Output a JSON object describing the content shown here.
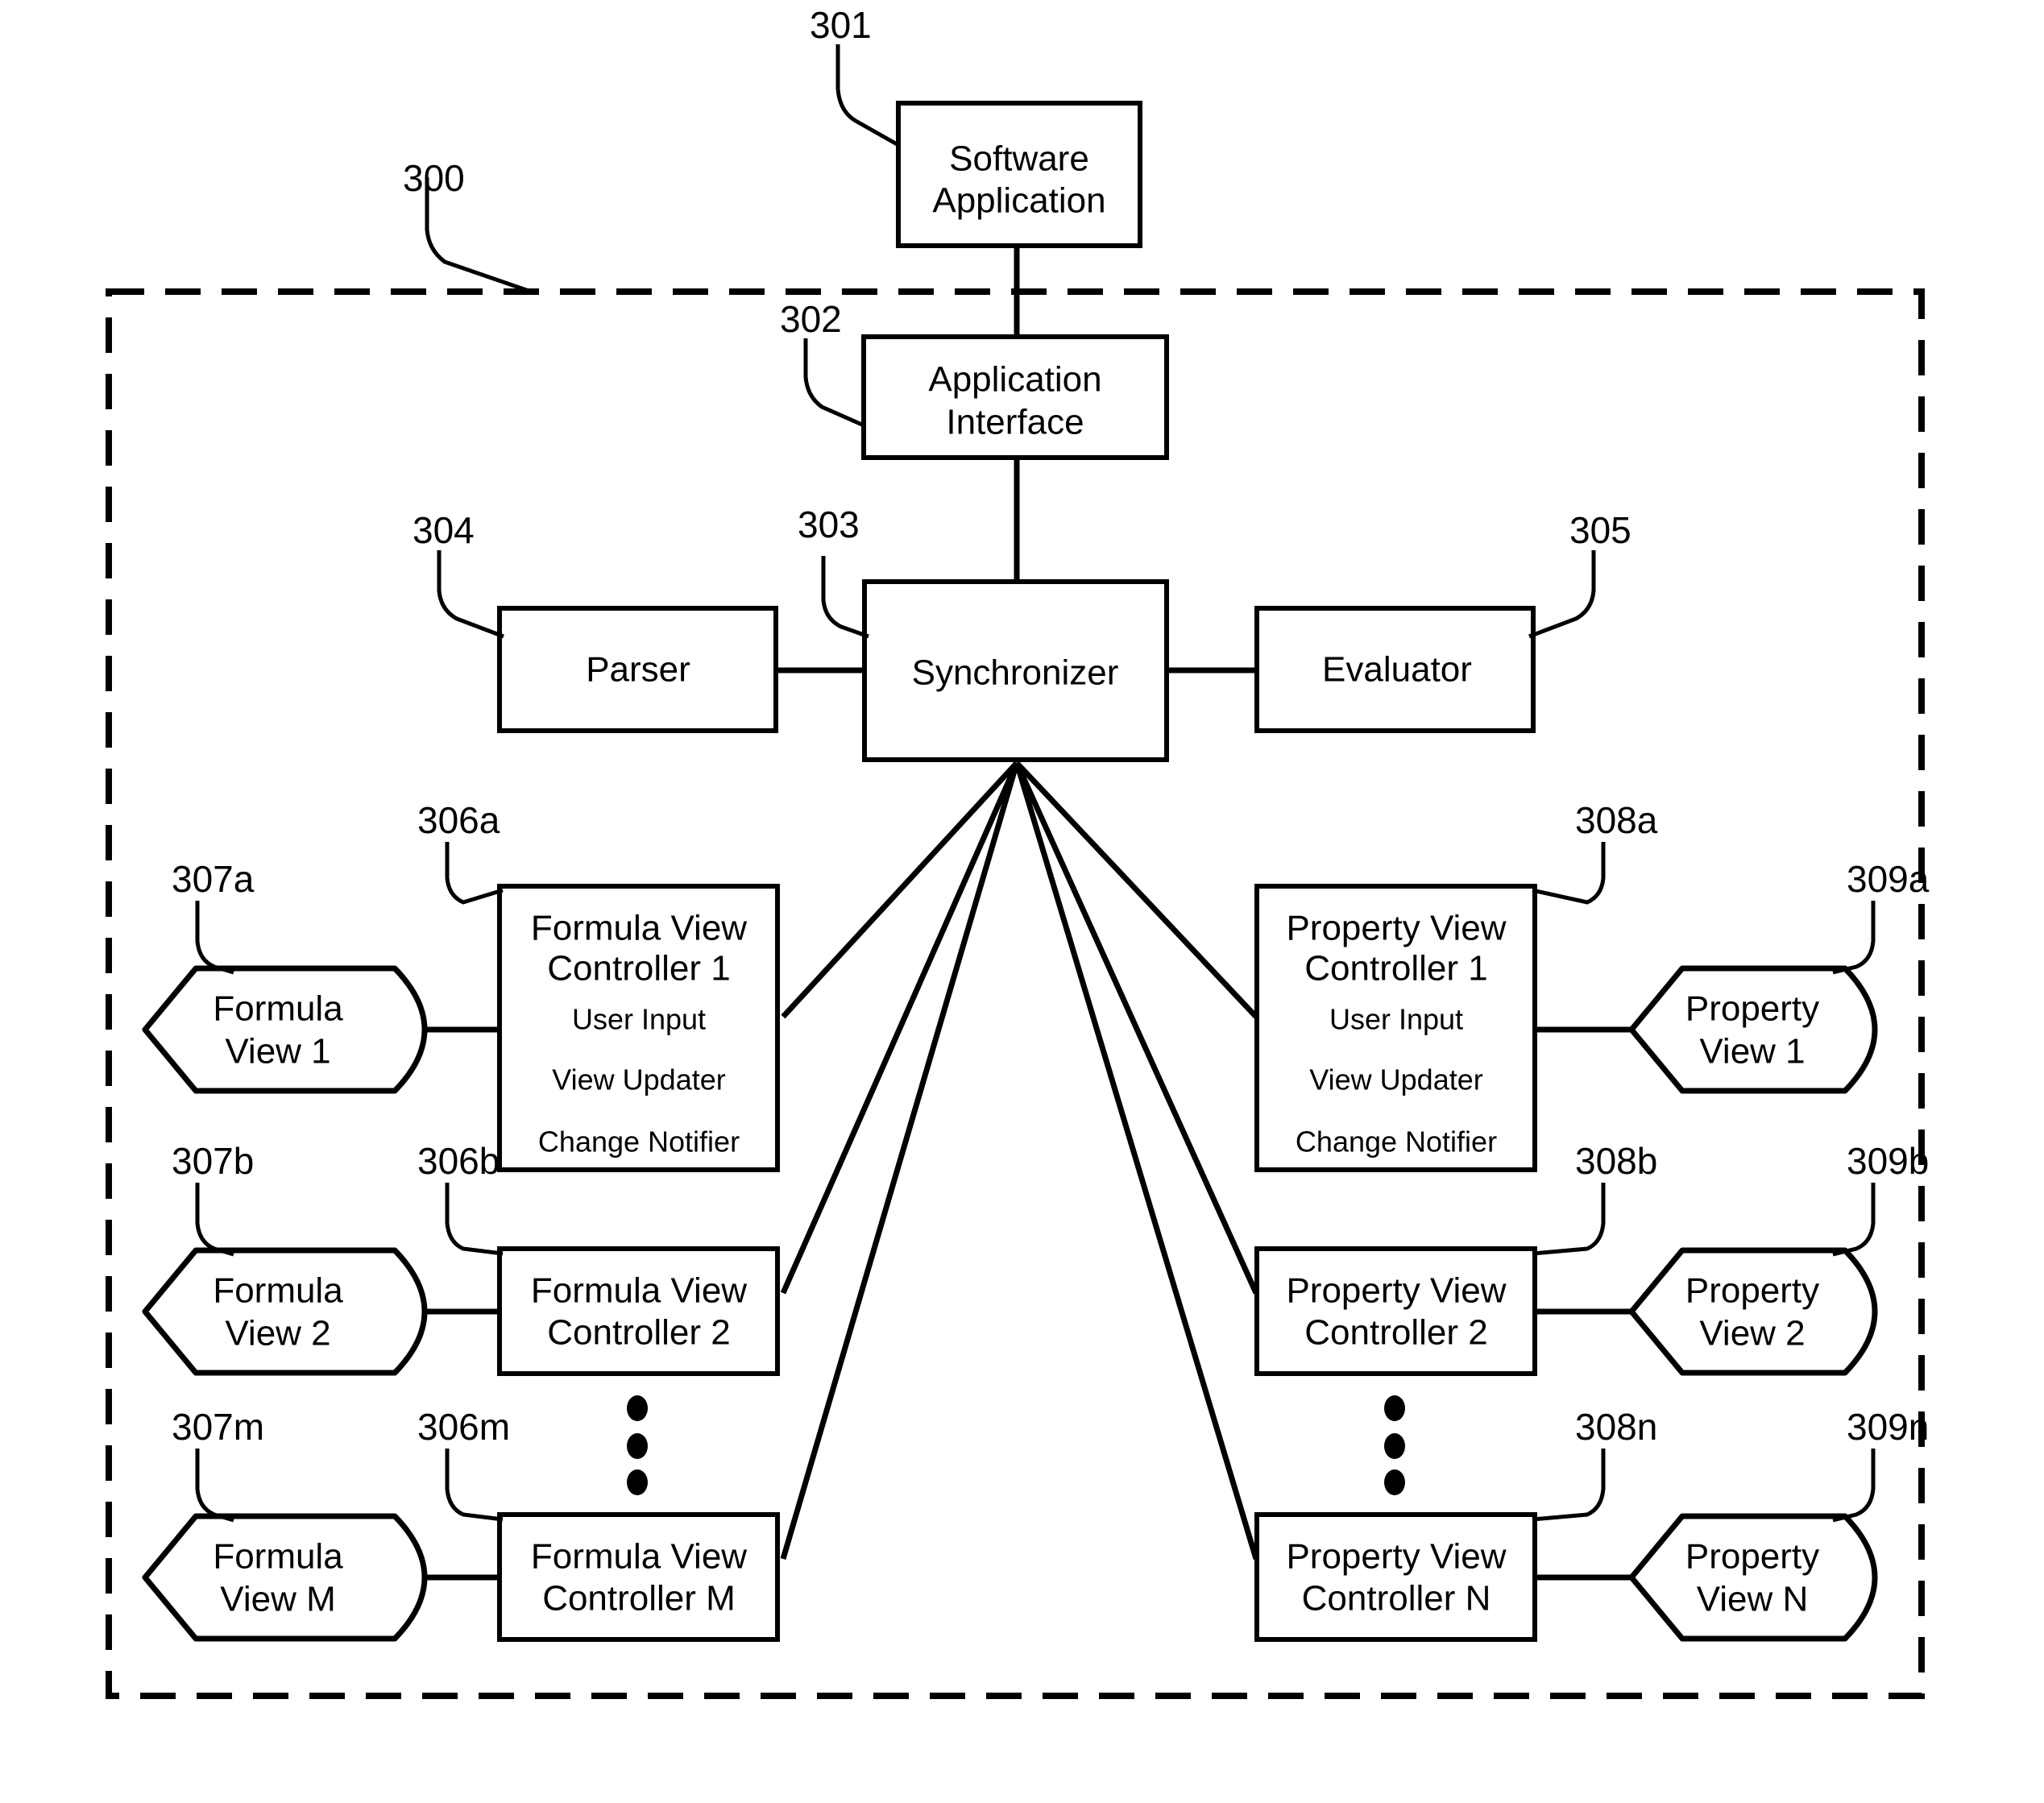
{
  "figure": {
    "type": "patent-block-diagram",
    "system_ref": "300"
  },
  "boxes": {
    "software_application": {
      "label_line1": "Software",
      "label_line2": "Application",
      "ref": "301"
    },
    "application_interface": {
      "label_line1": "Application",
      "label_line2": "Interface",
      "ref": "302"
    },
    "synchronizer": {
      "label": "Synchronizer",
      "ref": "303"
    },
    "parser": {
      "label": "Parser",
      "ref": "304"
    },
    "evaluator": {
      "label": "Evaluator",
      "ref": "305"
    }
  },
  "controller_sublabels": {
    "user_input": "User Input",
    "view_updater": "View Updater",
    "change_notifier": "Change Notifier"
  },
  "formula_controllers": [
    {
      "line1": "Formula View",
      "line2": "Controller 1",
      "ref": "306a",
      "expanded": true
    },
    {
      "line1": "Formula View",
      "line2": "Controller 2",
      "ref": "306b",
      "expanded": false
    },
    {
      "line1": "Formula View",
      "line2": "Controller M",
      "ref": "306m",
      "expanded": false
    }
  ],
  "formula_views": [
    {
      "line1": "Formula",
      "line2": "View 1",
      "ref": "307a"
    },
    {
      "line1": "Formula",
      "line2": "View 2",
      "ref": "307b"
    },
    {
      "line1": "Formula",
      "line2": "View M",
      "ref": "307m"
    }
  ],
  "property_controllers": [
    {
      "line1": "Property View",
      "line2": "Controller 1",
      "ref": "308a",
      "expanded": true
    },
    {
      "line1": "Property View",
      "line2": "Controller 2",
      "ref": "308b",
      "expanded": false
    },
    {
      "line1": "Property View",
      "line2": "Controller N",
      "ref": "308n",
      "expanded": false
    }
  ],
  "property_views": [
    {
      "line1": "Property",
      "line2": "View 1",
      "ref": "309a"
    },
    {
      "line1": "Property",
      "line2": "View 2",
      "ref": "309b"
    },
    {
      "line1": "Property",
      "line2": "View N",
      "ref": "309n"
    }
  ],
  "ellipsis": {
    "left_dots": 3,
    "right_dots": 3
  },
  "colors": {
    "stroke": "#000000",
    "fill": "#ffffff",
    "background": "#ffffff"
  }
}
